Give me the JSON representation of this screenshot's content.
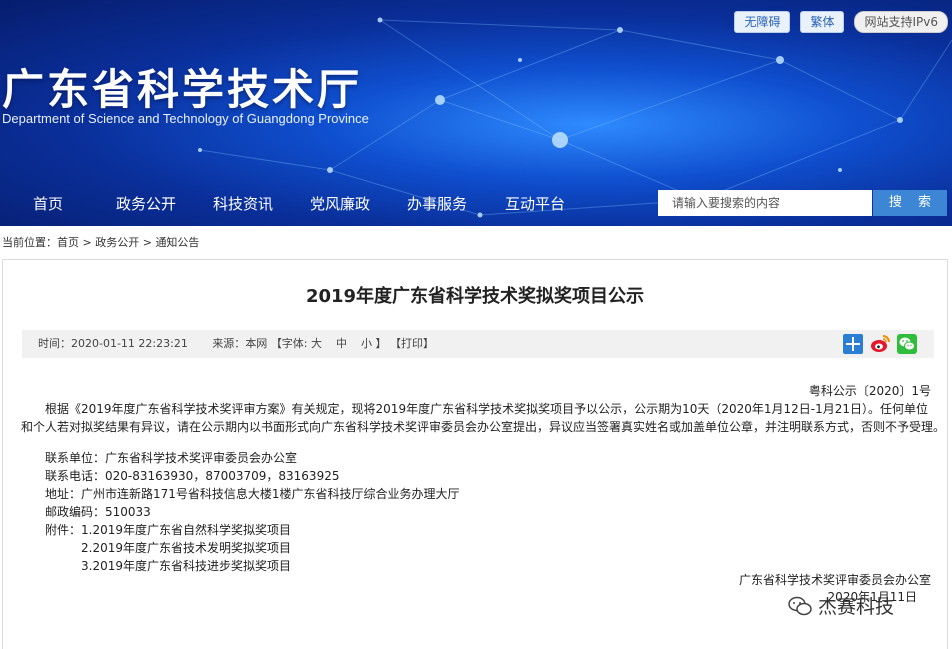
{
  "header": {
    "top_links": [
      "无障碍",
      "繁体",
      "网站支持IPv6"
    ],
    "site_title": "广东省科学技术厅",
    "site_subtitle": "Department of Science and Technology of Guangdong Province",
    "nav": [
      "首页",
      "政务公开",
      "科技资讯",
      "党风廉政",
      "办事服务",
      "互动平台"
    ],
    "search": {
      "placeholder": "请输入要搜索的内容",
      "button_label": "搜 索"
    }
  },
  "breadcrumb": {
    "prefix": "当前位置：",
    "items": [
      "首页",
      "政务公开",
      "通知公告"
    ],
    "separator": " > "
  },
  "article": {
    "title": "2019年度广东省科学技术奖拟奖项目公示",
    "meta": {
      "time_label": "时间：",
      "time": "2020-01-11 22:23:21",
      "source_label": "来源：",
      "source": "本网",
      "font_label": "【字体:",
      "font_large": "大",
      "font_medium": "中",
      "font_small": "小",
      "font_close": "】",
      "print": "【打印】"
    },
    "share_icons": [
      "plus-share-icon",
      "weibo-icon",
      "wechat-icon"
    ],
    "doc_number": "粤科公示〔2020〕1号",
    "paragraph_line1": "根据《2019年度广东省科学技术奖评审方案》有关规定，现将2019年度广东省科学技术奖拟奖项目予以公示，公示期为10天（2020年1月12日-1月21日）。任何单位",
    "paragraph_line2": "和个人若对拟奖结果有异议，请在公示期内以书面形式向广东省科学技术奖评审委员会办公室提出，异议应当签署真实姓名或加盖单位公章，并注明联系方式，否则不予受理。",
    "contact_unit": "联系单位：广东省科学技术奖评审委员会办公室",
    "contact_phone": "联系电话：020-83163930，87003709，83163925",
    "address": "地址：广州市连新路171号省科技信息大楼1楼广东省科技厅综合业务办理大厅",
    "postcode": "邮政编码：510033",
    "attachments_label": "附件：",
    "attachments": [
      "1.2019年度广东省自然科学奖拟奖项目",
      "2.2019年度广东省技术发明奖拟奖项目",
      "3.2019年度广东省科技进步奖拟奖项目"
    ],
    "signature_org": "广东省科学技术奖评审委员会办公室",
    "signature_date": "2020年1月11日"
  },
  "watermark": "杰赛科技"
}
